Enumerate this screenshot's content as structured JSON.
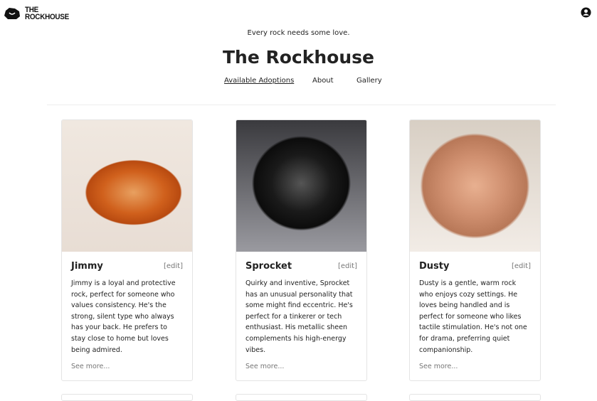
{
  "header": {
    "logo_line1": "THE",
    "logo_line2": "ROCKHOUSE",
    "tagline": "Every rock needs some love.",
    "title": "The Rockhouse"
  },
  "nav": [
    {
      "label": "Available Adoptions",
      "active": true
    },
    {
      "label": "About"
    },
    {
      "label": "Gallery"
    }
  ],
  "cards": [
    {
      "name": "Jimmy",
      "edit": "[edit]",
      "description": "Jimmy is a loyal and protective rock, perfect for someone who values consistency. He's the strong, silent type who always has your back. He prefers to stay close to home but loves being admired.",
      "more": "See more..."
    },
    {
      "name": "Sprocket",
      "edit": "[edit]",
      "description": "Quirky and inventive, Sprocket has an unusual personality that some might find eccentric. He's perfect for a tinkerer or tech enthusiast. His metallic sheen complements his high-energy vibes.",
      "more": "See more..."
    },
    {
      "name": "Dusty",
      "edit": "[edit]",
      "description": "Dusty is a gentle, warm rock who enjoys cozy settings. He loves being handled and is perfect for someone who likes tactile stimulation. He's not one for drama, preferring quiet companionship.",
      "more": "See more..."
    }
  ]
}
